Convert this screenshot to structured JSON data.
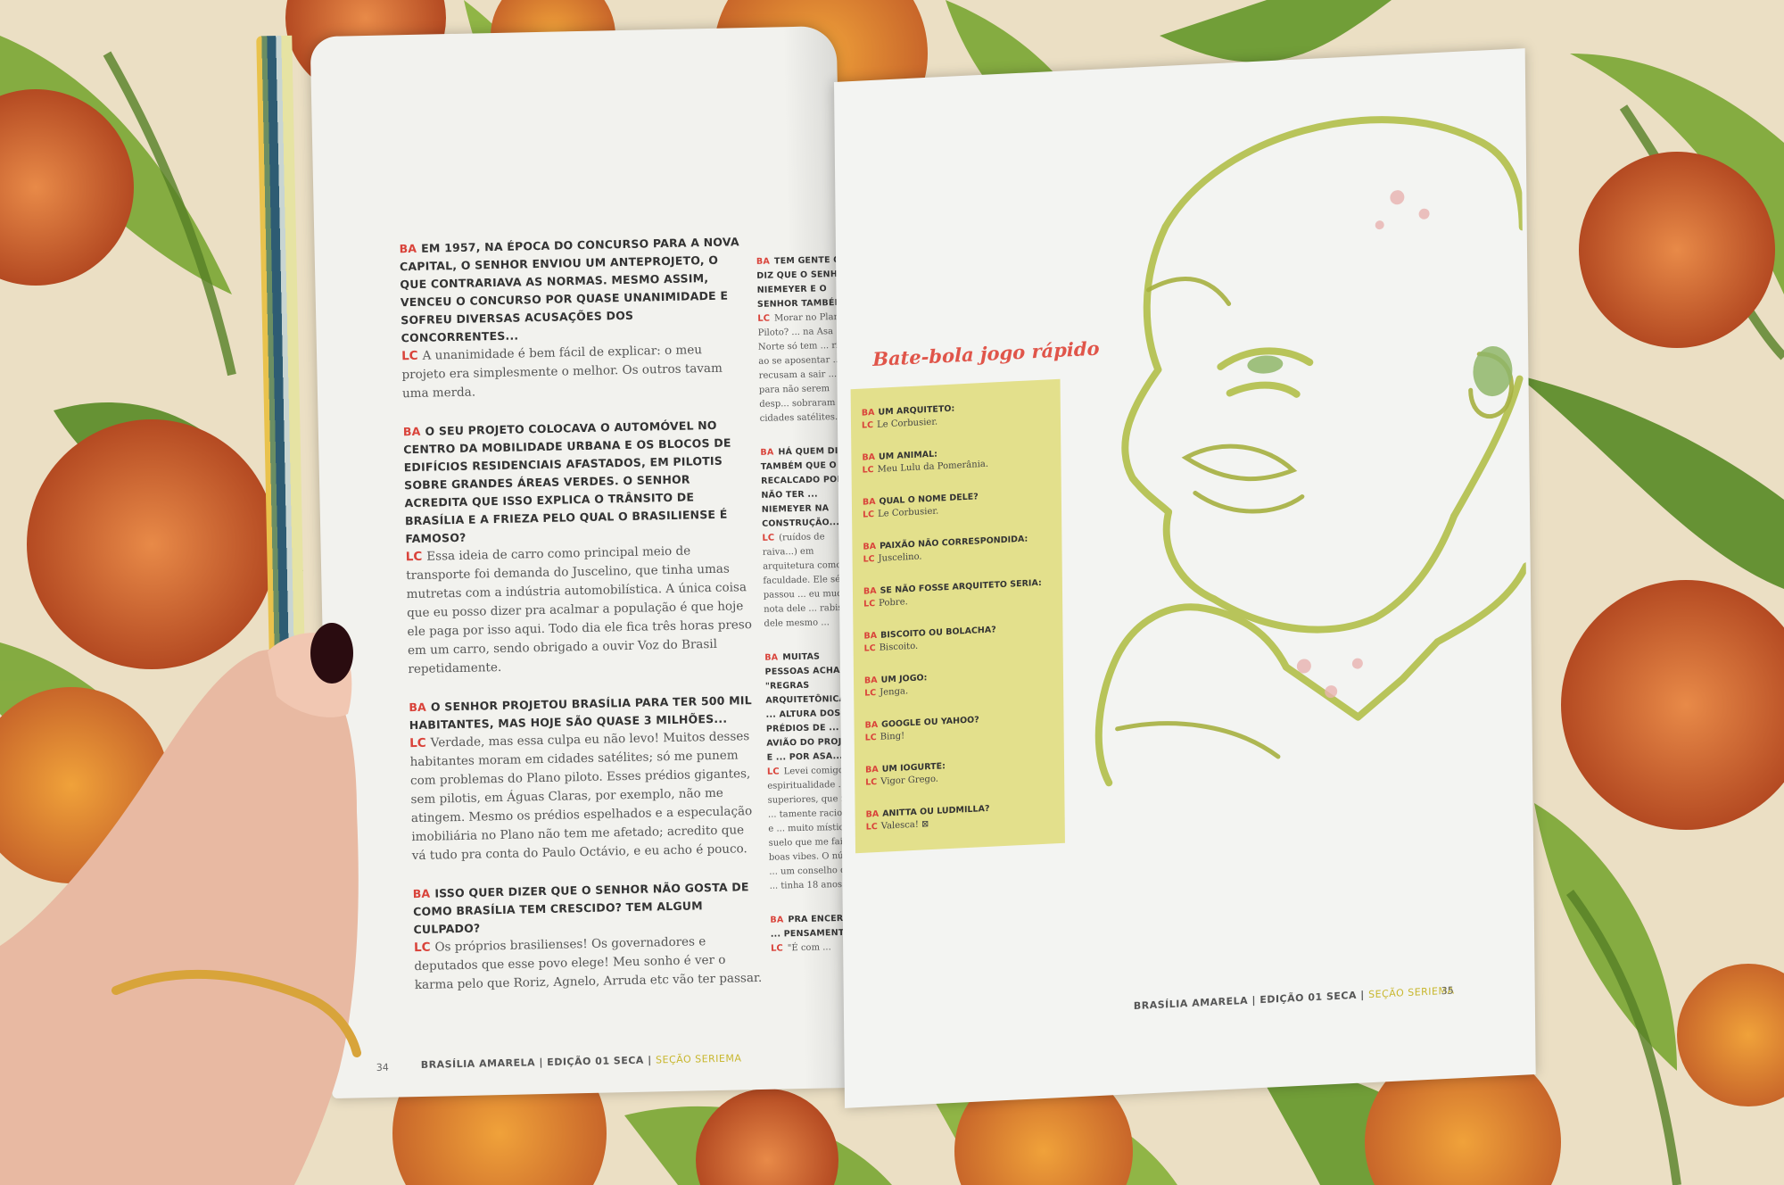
{
  "left_page": {
    "column1": [
      {
        "q": "EM 1957, NA ÉPOCA DO CONCURSO PARA A NOVA CAPITAL, O SENHOR ENVIOU UM ANTEPROJETO, O QUE CONTRARIAVA AS NORMAS. MESMO ASSIM, VENCEU O CONCURSO POR QUASE UNANIMIDADE E SOFREU DIVERSAS ACUSAÇÕES DOS CONCORRENTES...",
        "a": "A unanimidade é bem fácil de explicar: o meu projeto era simplesmente o melhor. Os outros tavam uma merda."
      },
      {
        "q": "O SEU PROJETO COLOCAVA O AUTOMÓVEL NO CENTRO DA MOBILIDADE URBANA E OS BLOCOS DE EDIFÍCIOS RESIDENCIAIS AFASTADOS, EM PILOTIS SOBRE GRANDES ÁREAS VERDES. O SENHOR ACREDITA QUE ISSO EXPLICA O TRÂNSITO DE BRASÍLIA E A FRIEZA PELO QUAL O BRASILIENSE É FAMOSO?",
        "a": "Essa ideia de carro como principal meio de transporte foi demanda do Juscelino, que tinha umas mutretas com a indústria automobilística. A única coisa que eu posso dizer pra acalmar a população é que hoje ele paga por isso aqui. Todo dia ele fica três horas preso em um carro, sendo obrigado a ouvir Voz do Brasil repetidamente."
      },
      {
        "q": "O SENHOR PROJETOU BRASÍLIA PARA TER 500 MIL HABITANTES, MAS HOJE SÃO QUASE 3 MILHÕES...",
        "a": "Verdade, mas essa culpa eu não levo! Muitos desses habitantes moram em cidades satélites; só me punem com problemas do Plano piloto. Esses prédios gigantes, sem pilotis, em Águas Claras, por exemplo, não me atingem. Mesmo os prédios espelhados e a especulação imobiliária no Plano não tem me afetado; acredito que vá tudo pra conta do Paulo Octávio, e eu acho é pouco."
      },
      {
        "q": "ISSO QUER DIZER QUE O SENHOR NÃO GOSTA DE COMO BRASÍLIA TEM CRESCIDO? TEM ALGUM CULPADO?",
        "a": "Os próprios brasilienses! Os governadores e deputados que esse povo elege! Meu sonho é ver o karma pelo que Roriz, Agnelo, Arruda etc vão ter passar."
      }
    ],
    "column2": [
      {
        "q": "TEM GENTE QUE DIZ QUE O SENHOR NIEMEYER E O SENHOR TAMBÉM...",
        "a": "Morar no Plano Piloto? ... na Asa Norte só tem ... ria, ao se aposentar ... se recusam a sair ... para não serem desp... sobraram as cidades satélites."
      },
      {
        "q": "HÁ QUEM DIGA TAMBÉM QUE O RECALCADO POR NÃO TER ... NIEMEYER NA CONSTRUÇÃO...",
        "a": "(ruídos de raiva...) em arquitetura como ... faculdade. Ele sé passou ... eu mudei a nota dele ... rabiscos dele mesmo ..."
      },
      {
        "q": "MUITAS PESSOAS ACHAM ... \"REGRAS ARQUITETÔNICAS\" ... ALTURA DOS PRÉDIOS DE ... AVIÃO DO PROJETO E ... POR ASA...",
        "a": "Levei comigo ... e espiritualidade ... superiores, que me ... tamente racionais e ... muito místico ... suelo que me faixa ... boas vibes. O número ... um conselho dessa ... tinha 18 anos ..."
      },
      {
        "q": "PRA ENCERRAR ... PENSAMENTO ...",
        "a": "\"É com ..."
      }
    ],
    "footer": {
      "page": "34",
      "magazine": "BRASÍLIA AMARELA",
      "edition": "EDIÇÃO 01 SECA",
      "section": "SEÇÃO SERIEMA"
    }
  },
  "right_page": {
    "title": "Bate-bola jogo rápido",
    "items": [
      {
        "q": "UM ARQUITETO:",
        "a": "Le Corbusier."
      },
      {
        "q": "UM ANIMAL:",
        "a": "Meu Lulu da Pomerânia."
      },
      {
        "q": "QUAL O NOME DELE?",
        "a": "Le Corbusier."
      },
      {
        "q": "PAIXÃO NÃO CORRESPONDIDA:",
        "a": "Juscelino."
      },
      {
        "q": "SE NÃO FOSSE ARQUITETO SERIA:",
        "a": "Pobre."
      },
      {
        "q": "BISCOITO OU BOLACHA?",
        "a": "Biscoito."
      },
      {
        "q": "UM JOGO:",
        "a": "Jenga."
      },
      {
        "q": "GOOGLE OU YAHOO?",
        "a": "Bing!"
      },
      {
        "q": "UM IOGURTE:",
        "a": "Vigor Grego."
      },
      {
        "q": "ANITTA OU LUDMILLA?",
        "a": "Valesca! ⊠"
      }
    ],
    "footer": {
      "page": "35",
      "magazine": "BRASÍLIA AMARELA",
      "edition": "EDIÇÃO 01 SECA",
      "section": "SEÇÃO SERIEMA"
    }
  },
  "tags": {
    "ba": "BA",
    "lc": "LC"
  },
  "colors": {
    "accent_red": "#d9433a",
    "box_yellow": "#e3e08c",
    "sketch_green": "#b8c45a",
    "nail": "#2a0c10"
  }
}
